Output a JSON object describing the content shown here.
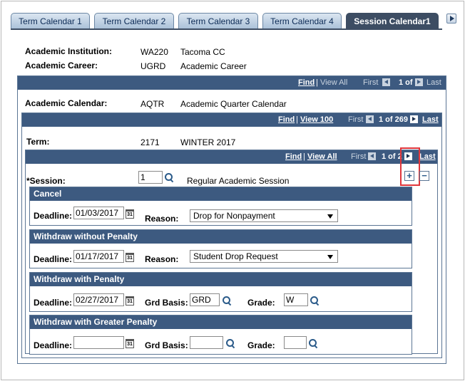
{
  "tabs": [
    {
      "label": "Term Calendar 1",
      "active": false
    },
    {
      "label": "Term Calendar 2",
      "active": false
    },
    {
      "label": "Term Calendar 3",
      "active": false
    },
    {
      "label": "Term Calendar 4",
      "active": false
    },
    {
      "label": "Session Calendar1",
      "active": true
    }
  ],
  "header": {
    "institution_label": "Academic Institution:",
    "institution_code": "WA220",
    "institution_name": "Tacoma CC",
    "career_label": "Academic Career:",
    "career_code": "UGRD",
    "career_name": "Academic Career"
  },
  "calendar_nav": {
    "find": "Find",
    "view_all": "View All",
    "first": "First",
    "count": "1 of 1",
    "last": "Last"
  },
  "calendar": {
    "label": "Academic Calendar:",
    "code": "AQTR",
    "name": "Academic Quarter Calendar"
  },
  "term_nav": {
    "find": "Find",
    "view": "View 100",
    "first": "First",
    "count": "1 of 269",
    "last": "Last"
  },
  "term": {
    "label": "Term:",
    "code": "2171",
    "name": "WINTER 2017"
  },
  "session_nav": {
    "find": "Find",
    "view_all": "View All",
    "first": "First",
    "count": "1 of 2",
    "last": "Last"
  },
  "session": {
    "label": "*Session:",
    "value": "1",
    "name": "Regular Academic Session"
  },
  "groups": {
    "cancel": {
      "title": "Cancel",
      "deadline_label": "Deadline:",
      "deadline": "01/03/2017",
      "reason_label": "Reason:",
      "reason": "Drop for Nonpayment"
    },
    "wd_no_penalty": {
      "title": "Withdraw without Penalty",
      "deadline_label": "Deadline:",
      "deadline": "01/17/2017",
      "reason_label": "Reason:",
      "reason": "Student Drop Request"
    },
    "wd_penalty": {
      "title": "Withdraw with Penalty",
      "deadline_label": "Deadline:",
      "deadline": "02/27/2017",
      "grd_basis_label": "Grd Basis:",
      "grd_basis": "GRD",
      "grade_label": "Grade:",
      "grade": "W"
    },
    "wd_greater_penalty": {
      "title": "Withdraw with Greater Penalty",
      "deadline_label": "Deadline:",
      "deadline": "",
      "grd_basis_label": "Grd Basis:",
      "grd_basis": "",
      "grade_label": "Grade:",
      "grade": ""
    }
  },
  "colors": {
    "header_bar": "#3d5a80",
    "active_tab": "#3d4d63",
    "highlight": "#e0363b"
  },
  "icons": {
    "calendar": "calendar-icon",
    "lookup": "magnifier-icon",
    "add": "plus-icon",
    "delete": "minus-icon"
  }
}
